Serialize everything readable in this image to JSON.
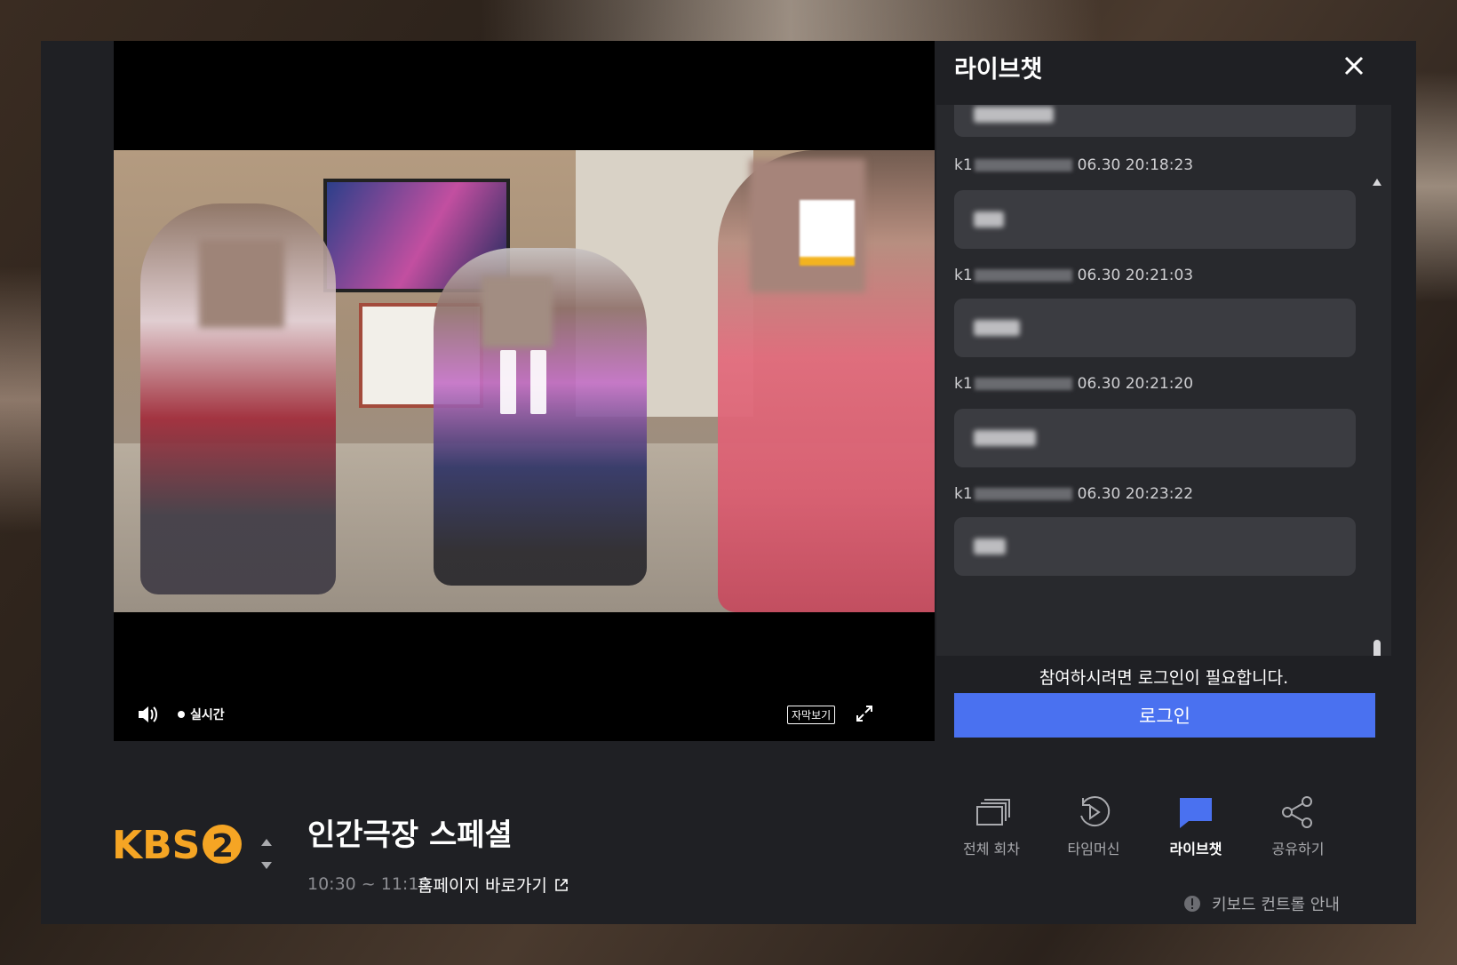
{
  "player": {
    "live_label": "실시간",
    "subtitle_label": "자막보기"
  },
  "chat": {
    "title": "라이브챗",
    "messages": [
      {
        "user_prefix": "",
        "time": ""
      },
      {
        "user_prefix": "k1",
        "time": "06.30 20:18:23"
      },
      {
        "user_prefix": "k1",
        "time": "06.30 20:21:03"
      },
      {
        "user_prefix": "k1",
        "time": "06.30 20:21:20"
      },
      {
        "user_prefix": "k1",
        "time": "06.30 20:23:22"
      }
    ],
    "login_required": "참여하시려면 로그인이 필요합니다.",
    "login_button": "로그인"
  },
  "program": {
    "channel_logo": "KBS2",
    "title": "인간극장 스페셜",
    "time": "10:30 ~ 11:10",
    "homepage_link": "홈페이지 바로가기"
  },
  "actions": [
    {
      "label": "전체 회차",
      "icon": "episodes-icon",
      "active": false
    },
    {
      "label": "타임머신",
      "icon": "timemachine-icon",
      "active": false
    },
    {
      "label": "라이브챗",
      "icon": "chat-bubble-icon",
      "active": true
    },
    {
      "label": "공유하기",
      "icon": "share-icon",
      "active": false
    }
  ],
  "keyboard_guide": "키보드 컨트롤 안내",
  "colors": {
    "accent_blue": "#4a71f0",
    "panel_bg": "#1f2024",
    "kbs_orange": "#f5a524"
  }
}
